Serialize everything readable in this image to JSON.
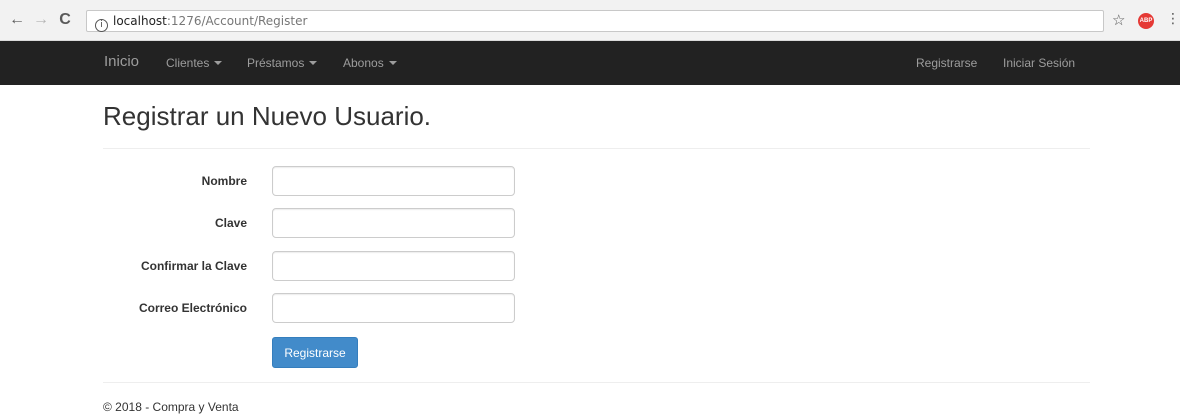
{
  "browser": {
    "url_host": "localhost",
    "url_path": ":1276/Account/Register",
    "back_glyph": "←",
    "forward_glyph": "→",
    "reload_glyph": "C",
    "star_glyph": "☆",
    "abp_label": "ABP",
    "menu_glyph": "⋮",
    "info_glyph": "i"
  },
  "navbar": {
    "brand": "Inicio",
    "items": [
      {
        "label": "Clientes"
      },
      {
        "label": "Préstamos"
      },
      {
        "label": "Abonos"
      }
    ],
    "right_items": [
      {
        "label": "Registrarse"
      },
      {
        "label": "Iniciar Sesión"
      }
    ],
    "background": "#222222",
    "text_color": "#9d9d9d"
  },
  "main": {
    "title": "Registrar un Nuevo Usuario.",
    "fields": [
      {
        "label": "Nombre",
        "value": ""
      },
      {
        "label": "Clave",
        "value": ""
      },
      {
        "label": "Confirmar la Clave",
        "value": ""
      },
      {
        "label": "Correo Electrónico",
        "value": ""
      }
    ],
    "submit_label": "Registrarse",
    "accent": "#428bca"
  },
  "footer": {
    "text": "© 2018 - Compra y Venta"
  }
}
